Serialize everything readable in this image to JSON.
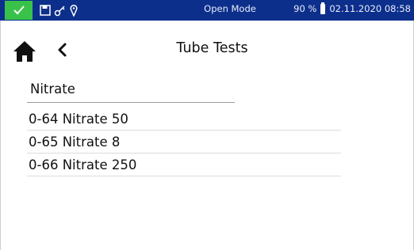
{
  "status": {
    "mode": "Open Mode",
    "battery_percent": "90 %",
    "datetime": "02.11.2020 08:58",
    "colors": {
      "bar": "#0d2f8c",
      "ok": "#39c24a"
    },
    "icons": [
      "check-icon",
      "save-icon",
      "key-icon",
      "location-pin-icon",
      "battery-icon"
    ]
  },
  "nav": {
    "icons": [
      "home-icon",
      "back-icon"
    ]
  },
  "header": {
    "title": "Tube Tests"
  },
  "section": {
    "label": "Nitrate"
  },
  "tests": [
    {
      "label": "0-64 Nitrate 50"
    },
    {
      "label": "0-65 Nitrate 8"
    },
    {
      "label": "0-66 Nitrate 250"
    }
  ]
}
